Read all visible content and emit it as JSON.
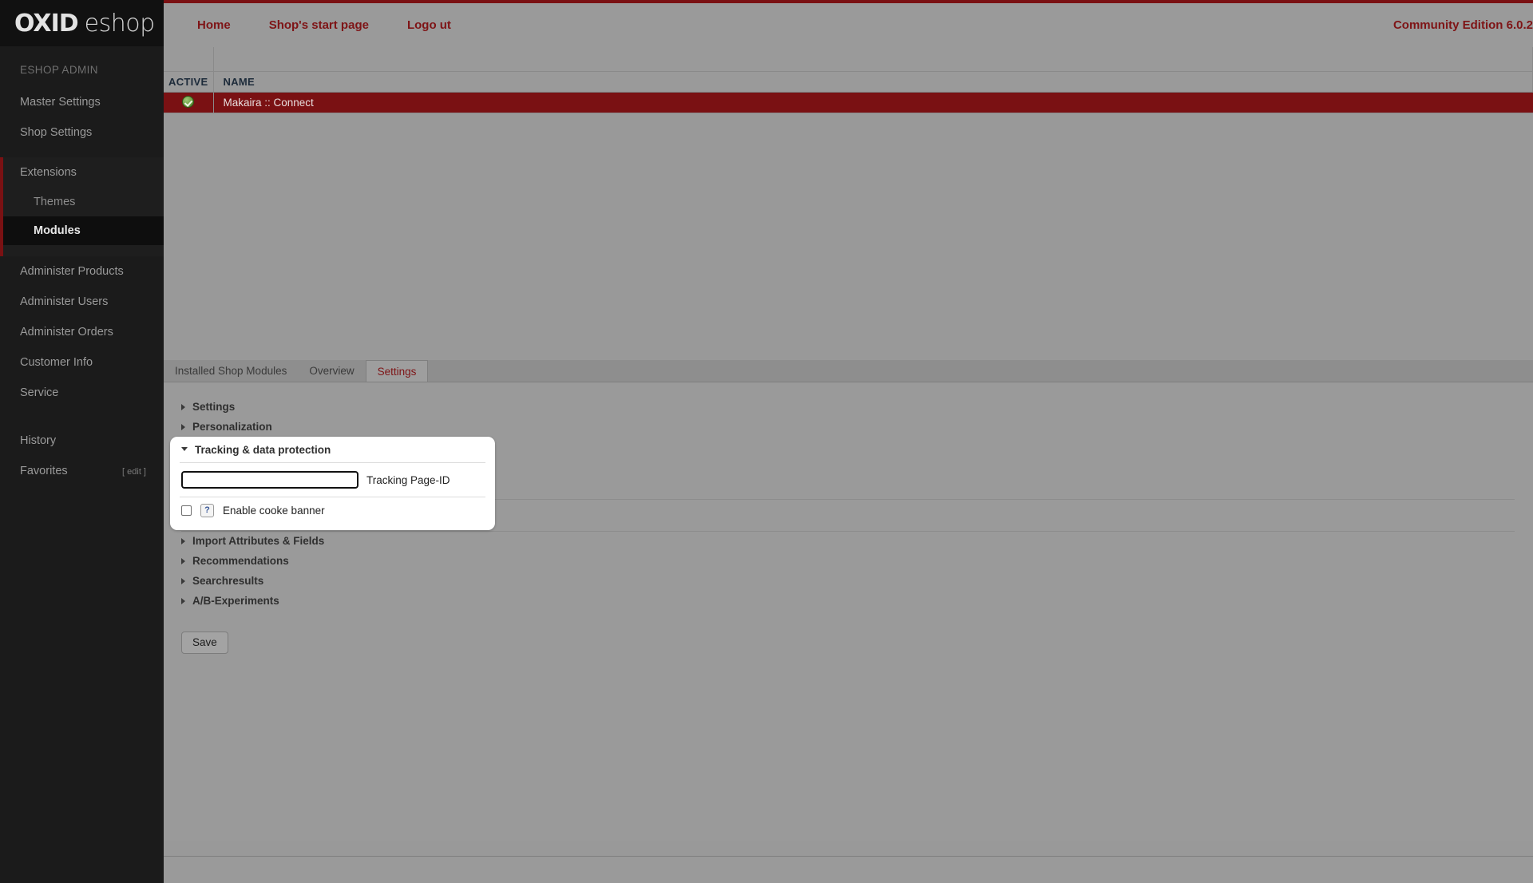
{
  "brand": {
    "logo_primary": "OXID",
    "logo_secondary": "eshop",
    "admin_label": "ESHOP ADMIN",
    "accent_red": "#7a1113",
    "sidebar_bg": "#1b1b1b",
    "content_bg": "#999999"
  },
  "topbar": {
    "links": [
      {
        "label": "Home"
      },
      {
        "label": "Shop's start page"
      },
      {
        "label": "Logo ut"
      }
    ],
    "edition": "Community Edition 6.0.2"
  },
  "sidebar": {
    "items": [
      {
        "label": "Master Settings"
      },
      {
        "label": "Shop Settings"
      }
    ],
    "extensions": {
      "label": "Extensions",
      "children": [
        {
          "label": "Themes",
          "active": false
        },
        {
          "label": "Modules",
          "active": true
        }
      ]
    },
    "items_after": [
      {
        "label": "Administer Products"
      },
      {
        "label": "Administer Users"
      },
      {
        "label": "Administer Orders"
      },
      {
        "label": "Customer Info"
      },
      {
        "label": "Service"
      }
    ],
    "history_label": "History",
    "favorites_label": "Favorites",
    "favorites_edit": "[ edit ]"
  },
  "module_list": {
    "columns": [
      "ACTIVE",
      "NAME"
    ],
    "rows": [
      {
        "active": true,
        "active_icon": "green-check-icon",
        "name": "Makaira :: Connect",
        "selected": true
      }
    ]
  },
  "tabs": [
    {
      "label": "Installed Shop Modules",
      "active": false
    },
    {
      "label": "Overview",
      "active": false
    },
    {
      "label": "Settings",
      "active": true
    }
  ],
  "settings": {
    "sections": [
      {
        "label": "Settings",
        "expanded": false
      },
      {
        "label": "Personalization",
        "expanded": false
      },
      {
        "label": "Tracking & data protection",
        "expanded": true
      },
      {
        "label": "Import Attributes & Fields",
        "expanded": false
      },
      {
        "label": "Recommendations",
        "expanded": false
      },
      {
        "label": "Searchresults",
        "expanded": false
      },
      {
        "label": "A/B-Experiments",
        "expanded": false
      }
    ],
    "tracking_panel": {
      "title": "Tracking & data protection",
      "page_id_value": "",
      "page_id_placeholder": "",
      "page_id_label": "Tracking Page-ID",
      "cookie_checkbox_checked": false,
      "cookie_help_glyph": "?",
      "cookie_label": "Enable cooke banner"
    },
    "save_label": "Save"
  }
}
